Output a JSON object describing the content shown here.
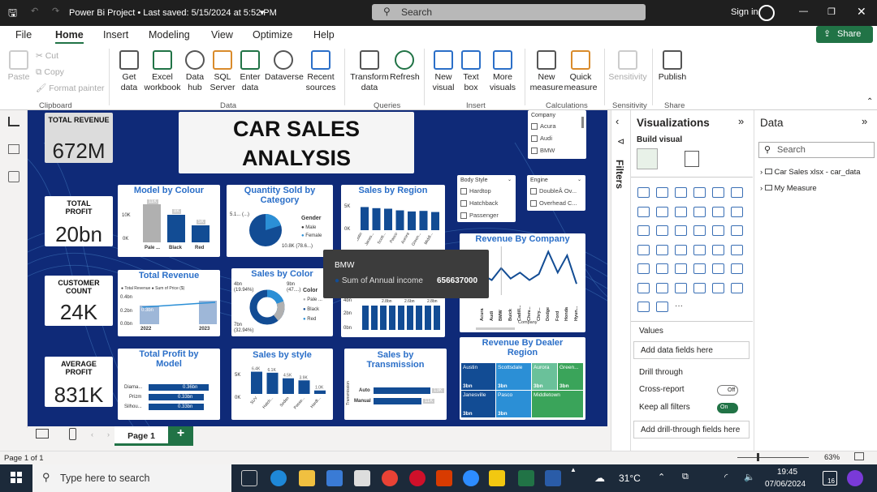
{
  "titlebar": {
    "title": "Power Bi Project • Last saved: 5/15/2024 at 5:52 PM",
    "search": "Search",
    "signin": "Sign in"
  },
  "menu": {
    "items": [
      "File",
      "Home",
      "Insert",
      "Modeling",
      "View",
      "Optimize",
      "Help"
    ],
    "share": "Share"
  },
  "ribbon": {
    "clipboard": {
      "paste": "Paste",
      "cut": "Cut",
      "copy": "Copy",
      "format": "Format painter",
      "group": "Clipboard"
    },
    "data": {
      "get": "Get data",
      "excel": "Excel workbook",
      "hub": "Data hub",
      "sql": "SQL Server",
      "enter": "Enter data",
      "dataverse": "Dataverse",
      "recent": "Recent sources",
      "group": "Data"
    },
    "queries": {
      "transform": "Transform data",
      "refresh": "Refresh",
      "group": "Queries"
    },
    "insert": {
      "newvisual": "New visual",
      "textbox": "Text box",
      "more": "More visuals",
      "group": "Insert"
    },
    "calc": {
      "newmeasure": "New measure",
      "quick": "Quick measure",
      "group": "Calculations"
    },
    "sensitivity": {
      "label": "Sensitivity",
      "group": "Sensitivity"
    },
    "share": {
      "publish": "Publish",
      "group": "Share"
    }
  },
  "report": {
    "title1": "CAR SALES",
    "title2": "ANALYSIS",
    "kpis": [
      {
        "label": "TOTAL REVENUE",
        "value": "672M"
      },
      {
        "label": "TOTAL PROFIT",
        "value": "20bn"
      },
      {
        "label": "CUSTOMER COUNT",
        "value": "24K"
      },
      {
        "label": "AVERAGE PROFIT",
        "value": "831K"
      }
    ],
    "model_by_colour": {
      "title": "Model by Colour",
      "y": [
        "10K",
        "0K"
      ],
      "labels": [
        "11K",
        "8K",
        "5K"
      ],
      "cats": [
        "Pale ...",
        "Black",
        "Red"
      ],
      "values": [
        11,
        8,
        5
      ]
    },
    "qty_category": {
      "title": "Quantity Sold by Category",
      "legend_title": "Gender",
      "legend": [
        "Male",
        "Female"
      ],
      "l1": "5.1... (...)",
      "l2": "10.8K (78.6...)"
    },
    "sales_region": {
      "title": "Sales by Region",
      "y": [
        "5K",
        "0K"
      ],
      "cats": [
        "Austin",
        "Janes...",
        "Scott...",
        "Pasco",
        "Aurora",
        "Green...",
        "Middl..."
      ],
      "values": [
        4.2,
        4.0,
        3.9,
        3.6,
        3.4,
        3.5,
        3.3
      ]
    },
    "body_style": {
      "title": "Body Style",
      "items": [
        "Hardtop",
        "Hatchback",
        "Passenger"
      ]
    },
    "engine": {
      "title": "Engine",
      "items": [
        "DoubleÂ Ov...",
        "Overhead C..."
      ]
    },
    "company": {
      "title": "Company",
      "items": [
        "Acura",
        "Audi",
        "BMW"
      ]
    },
    "total_revenue": {
      "title": "Total Revenue",
      "legend": [
        "Total Revenue",
        "Sum of Price ($)"
      ],
      "y": [
        "0.4bn",
        "0.2bn",
        "0.0bn"
      ],
      "cats": [
        "2022",
        "2023"
      ],
      "labels": [
        "0.3bn",
        ""
      ]
    },
    "sales_color": {
      "title": "Sales by Color",
      "legend_title": "Color",
      "legend": [
        "Pale ...",
        "Black",
        "Red"
      ],
      "l1": "4bn (19.94%)",
      "l2": "9bn (47....)",
      "l3": "7bn (32.94%)"
    },
    "revenue_company": {
      "title": "Revenue By Company",
      "xlabel": "Company",
      "cats": [
        "Acura",
        "Audi",
        "BMW",
        "Buick",
        "Cadill...",
        "Chev...",
        "Chry...",
        "Dodge",
        "Ford",
        "Honda",
        "Hyun..."
      ],
      "values": [
        0.57,
        0.5,
        0.66,
        0.52,
        0.6,
        0.5,
        0.58,
        0.88,
        0.6,
        0.83,
        0.45
      ]
    },
    "tooltip": {
      "title": "BMW",
      "label": "Sum of Annual income",
      "value": "656637000"
    },
    "sales_trend": {
      "labels": [
        "2.8bn",
        "2.6bn",
        "2.8bn"
      ],
      "y": [
        "4bn",
        "2bn",
        "0bn"
      ]
    },
    "profit_model": {
      "title": "Total Profit by Model",
      "cats": [
        "Diama...",
        "Prizm",
        "Silhou..."
      ],
      "labels": [
        "0.36bn",
        "0.33bn",
        "0.33bn"
      ],
      "values": [
        0.36,
        0.33,
        0.33
      ]
    },
    "sales_style": {
      "title": "Sales by style",
      "y": [
        "5K",
        "0K"
      ],
      "labels": [
        "6.4K",
        "6.1K",
        "4.5K",
        "3.9K",
        "1.0K"
      ],
      "cats": [
        "SUV",
        "Hatch...",
        "Sedan",
        "Passe...",
        "Hardt..."
      ],
      "values": [
        6.4,
        6.1,
        4.5,
        3.9,
        1.0
      ]
    },
    "sales_trans": {
      "title": "Sales by Transmission",
      "ylabel": "Transmission",
      "cats": [
        "Auto",
        "Manual"
      ],
      "labels": [
        "13K",
        "11K"
      ],
      "values": [
        13,
        11
      ]
    },
    "revenue_dealer": {
      "title": "Revenue By Dealer Region",
      "cells": [
        {
          "name": "Austin",
          "val": "3bn"
        },
        {
          "name": "Scottsdale",
          "val": "3bn"
        },
        {
          "name": "Aurora",
          "val": "3bn"
        },
        {
          "name": "Green...",
          "val": "3bn"
        },
        {
          "name": "Janesville",
          "val": "3bn"
        },
        {
          "name": "Pasco",
          "val": "3bn"
        },
        {
          "name": "Middletown",
          "val": "3bn"
        }
      ],
      "colors": [
        "#124c94",
        "#2b8fd6",
        "#6ac19a",
        "#3aa45a",
        "#124c94",
        "#2b8fd6",
        "#3aa45a"
      ]
    }
  },
  "panes": {
    "filters": "Filters",
    "viz": "Visualizations",
    "build": "Build visual",
    "values": "Values",
    "add_data": "Add data fields here",
    "drill": "Drill through",
    "cross": "Cross-report",
    "cross_state": "Off",
    "keep": "Keep all filters",
    "keep_state": "On",
    "add_drill": "Add drill-through fields here",
    "data": "Data",
    "data_search": "Search",
    "tables": [
      "Car Sales xlsx - car_data",
      "My Measure"
    ]
  },
  "pagebar": {
    "page": "Page 1"
  },
  "status": {
    "page": "Page 1 of 1",
    "zoom": "63%"
  },
  "taskbar": {
    "search": "Type here to search",
    "weather": "31°C",
    "time": "19:45",
    "date": "07/06/2024",
    "notif": "16"
  }
}
